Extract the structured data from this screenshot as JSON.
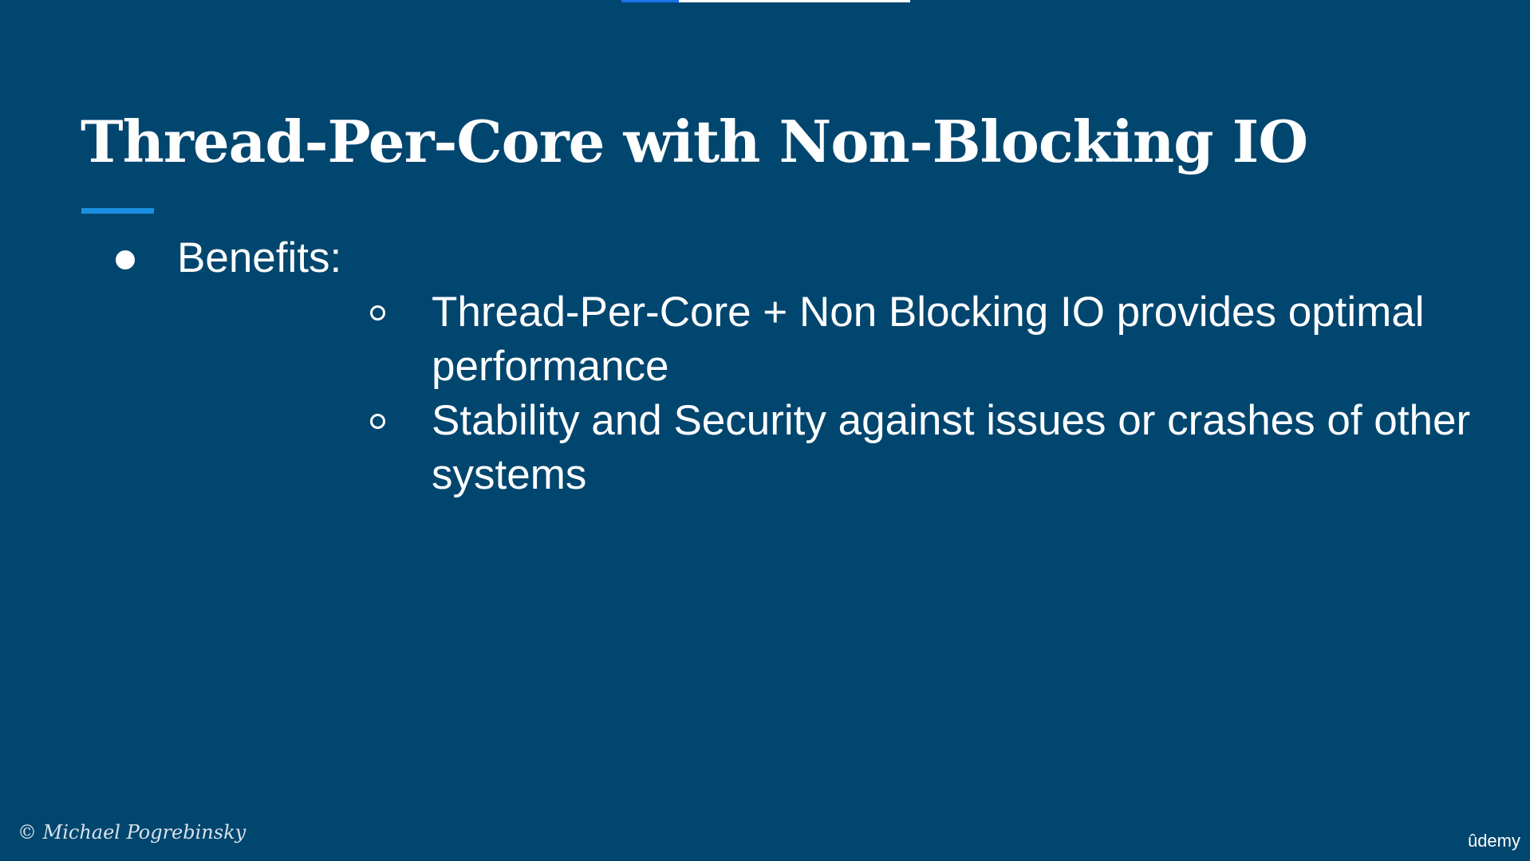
{
  "video": {
    "progress": 0.2,
    "progress_color": "#1a73e8"
  },
  "slide": {
    "title": "Thread-Per-Core with Non-Blocking IO",
    "accent_color": "#1a8fe0",
    "background_color": "#01466f",
    "bullets": [
      {
        "text": "Benefits:",
        "sub_bullets": [
          "Thread-Per-Core + Non Blocking IO provides optimal performance",
          "Stability and Security against issues or crashes of other systems"
        ]
      }
    ],
    "copyright": "© Michael Pogrebinsky"
  },
  "brand": {
    "logo_text": "ûdemy"
  }
}
